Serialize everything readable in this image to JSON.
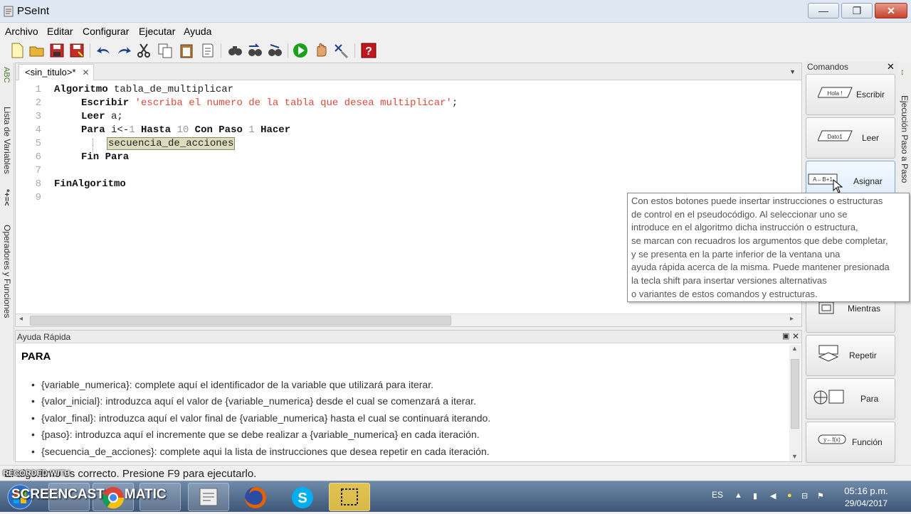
{
  "window": {
    "title": "PSeInt",
    "minimize": "—",
    "maximize": "❐",
    "close": "✕"
  },
  "menu": [
    "Archivo",
    "Editar",
    "Configurar",
    "Ejecutar",
    "Ayuda"
  ],
  "left_strip": {
    "variables_label": "Lista de Variables",
    "operators_label": "Operadores y Funciones",
    "vars_icon": "*+=<",
    "abc_icon": "ABC"
  },
  "editor": {
    "tab_title": "<sin_titulo>*",
    "tab_close": "✕",
    "line_numbers": [
      "1",
      "2",
      "3",
      "4",
      "5",
      "6",
      "7",
      "8",
      "9"
    ],
    "lines": {
      "l1_kw": "Algoritmo",
      "l1_rest": " tabla_de_multiplicar",
      "l2_kw": "Escribir",
      "l2_str": "'escriba el numero de la tabla que desea multiplicar'",
      "l2_end": ";",
      "l3_kw": "Leer",
      "l3_rest": " a;",
      "l4_kw1": "Para",
      "l4_var": " i<-",
      "l4_n1": "1",
      "l4_kw2": " Hasta",
      "l4_n2": " 10",
      "l4_kw3": " Con Paso",
      "l4_n3": " 1",
      "l4_kw4": " Hacer",
      "l5_ph": "secuencia_de_acciones",
      "l6_kw": "Fin Para",
      "l8_kw": "FinAlgoritmo"
    }
  },
  "help": {
    "header": "Ayuda Rápida",
    "title": "PARA",
    "bullets": [
      "{variable_numerica}: complete aquí el identificador de la variable que utilizará para iterar.",
      "{valor_inicial}: introduzca aquí el valor de {variable_numerica} desde el cual se comenzará a iterar.",
      "{valor_final}: introduzca aquí el valor final de {variable_numerica} hasta el cual se continuará iterando.",
      "{paso}: introduzca aquí el incremente que se debe realizar a {variable_numerica} en cada iteración.",
      "{secuencia_de_acciones}: complete aqui la lista de instrucciones que desea repetir en cada iteración."
    ]
  },
  "commands": {
    "header": "Comandos",
    "buttons": [
      {
        "label": "Escribir",
        "icon_text": "Hola !"
      },
      {
        "label": "Leer",
        "icon_text": "Dato1"
      },
      {
        "label": "Asignar",
        "icon_text": "A←B+1"
      },
      {
        "label": "Mientras",
        "icon_text": ""
      },
      {
        "label": "Repetir",
        "icon_text": ""
      },
      {
        "label": "Para",
        "icon_text": ""
      },
      {
        "label": "Función",
        "icon_text": "y←f(x)"
      }
    ]
  },
  "right_strip": {
    "label": "Ejecución Paso a Paso"
  },
  "tooltip": {
    "lines": [
      "Con estos botones puede insertar instrucciones o estructuras",
      "de control en el pseudocódigo. Al seleccionar uno se",
      "introduce en el algoritmo dicha instrucción o estructura,",
      "se marcan con recuadros los argumentos que debe completar,",
      "y se presenta en la parte inferior de la ventana una",
      "ayuda rápida acerca de la misma. Puede mantener presionada",
      "la tecla shift para insertar versiones alternativas",
      "o variantes de estos comandos y estructuras."
    ]
  },
  "status": {
    "text": "El algoritmo es correcto. Presione F9 para ejecutarlo."
  },
  "watermark": {
    "text": "RECORDED WITH"
  },
  "taskbar": {
    "screencast": "SCREENCAST",
    "matic": "MATIC",
    "lang": "ES",
    "time": "05:16 p.m.",
    "date": "29/04/2017"
  },
  "colors": {
    "string": "#d94a3a",
    "placeholder_bg": "#dcdcbc",
    "run_green": "#1aa31a",
    "help_red": "#c0181e"
  }
}
